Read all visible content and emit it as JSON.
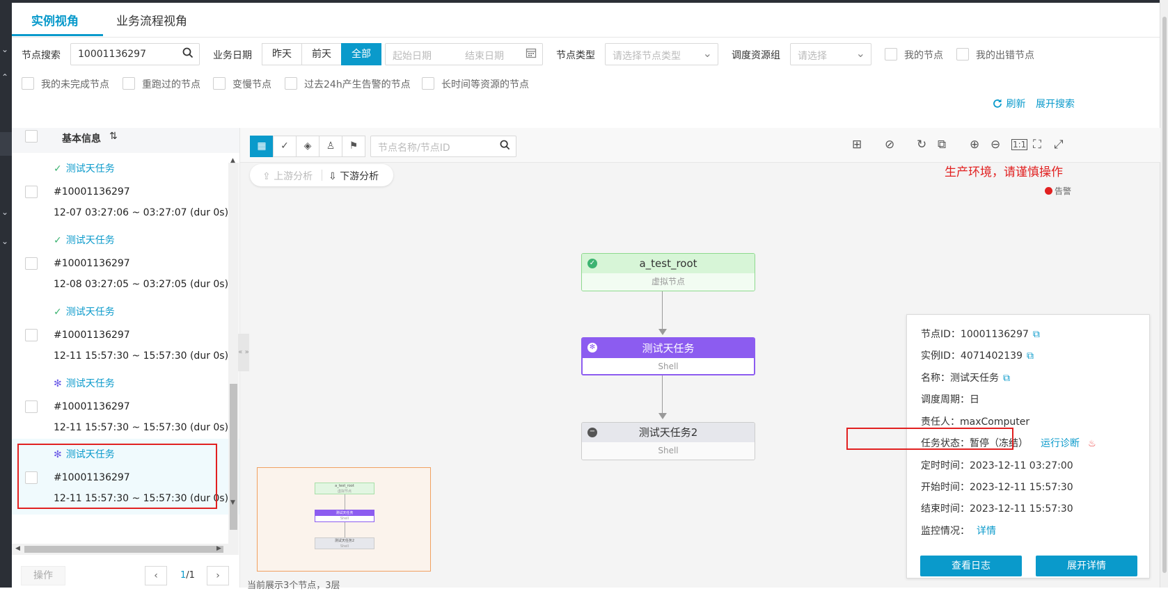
{
  "tabs": [
    {
      "label": "实例视角"
    },
    {
      "label": "业务流程视角"
    }
  ],
  "filters": {
    "node_search_label": "节点搜索",
    "node_search_value": "10001136297",
    "biz_date_label": "业务日期",
    "date_options": [
      "昨天",
      "前天",
      "全部"
    ],
    "start_date_placeholder": "起始日期",
    "end_date_placeholder": "结束日期",
    "node_type_label": "节点类型",
    "node_type_placeholder": "请选择节点类型",
    "resource_group_label": "调度资源组",
    "resource_group_placeholder": "请选择",
    "checkboxes_row1": [
      "我的节点",
      "我的出错节点"
    ],
    "checkboxes_row2": [
      "我的未完成节点",
      "重跑过的节点",
      "变慢节点",
      "过去24h产生告警的节点",
      "长时间等资源的节点"
    ],
    "refresh_label": "刷新",
    "expand_search_label": "展开搜索"
  },
  "list": {
    "header": "基本信息",
    "items": [
      {
        "status_icon": "check-circle",
        "name": "测试天任务",
        "id": "#10001136297",
        "time": "12-07 03:27:06 ~ 03:27:07 (dur 0s)"
      },
      {
        "status_icon": "check-circle",
        "name": "测试天任务",
        "id": "#10001136297",
        "time": "12-08 03:27:05 ~ 03:27:05 (dur 0s)"
      },
      {
        "status_icon": "check-circle",
        "name": "测试天任务",
        "id": "#10001136297",
        "time": "12-11 15:57:30 ~ 15:57:30 (dur 0s)"
      },
      {
        "status_icon": "asterisk-circle",
        "name": "测试天任务",
        "id": "#10001136297",
        "time": "12-11 15:57:30 ~ 15:57:30 (dur 0s)"
      },
      {
        "status_icon": "asterisk-circle",
        "name": "测试天任务",
        "id": "#10001136297",
        "time": "12-11 15:57:30 ~ 15:57:30 (dur 0s)"
      }
    ],
    "action_label": "操作",
    "page_current": "1",
    "page_total": "/1"
  },
  "canvas": {
    "search_placeholder": "节点名称/节点ID",
    "upstream_label": "上游分析",
    "downstream_label": "下游分析",
    "env_warning": "生产环境，请谨慎操作",
    "alert_label": "告警",
    "footer_text": "当前展示3个节点，3层",
    "nodes": [
      {
        "name": "a_test_root",
        "type": "虚拟节点",
        "state": "success"
      },
      {
        "name": "测试天任务",
        "type": "Shell",
        "state": "frozen"
      },
      {
        "name": "测试天任务2",
        "type": "Shell",
        "state": "paused"
      }
    ],
    "minimap_nodes": [
      "a_test_root",
      "测试天任务",
      "测试天任务2"
    ],
    "minimap_subtitles": [
      "虚拟节点",
      "Shell",
      "Shell"
    ]
  },
  "detail": {
    "node_id_label": "节点ID：",
    "node_id": "10001136297",
    "instance_id_label": "实例ID：",
    "instance_id": "4071402139",
    "name_label": "名称：",
    "name": "测试天任务",
    "cycle_label": "调度周期：",
    "cycle": "日",
    "owner_label": "责任人：",
    "owner": "maxComputer",
    "task_status_label": "任务状态：",
    "task_status": "暂停（冻结）",
    "diagnose_label": "运行诊断",
    "scheduled_time_label": "定时时间：",
    "scheduled_time": "2023-12-11 03:27:00",
    "start_time_label": "开始时间：",
    "start_time": "2023-12-11 15:57:30",
    "end_time_label": "结束时间：",
    "end_time": "2023-12-11 15:57:30",
    "monitor_label": "监控情况：",
    "monitor_link": "详情",
    "view_log_button": "查看日志",
    "expand_detail_button": "展开详情"
  },
  "colors": {
    "accent": "#0a9acb",
    "success": "#4cbf4c",
    "frozen": "#8c5cf0",
    "paused": "#6e7381",
    "warning": "#e12020"
  }
}
